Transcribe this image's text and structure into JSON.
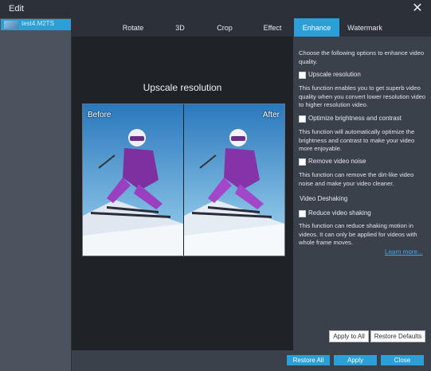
{
  "window": {
    "title": "Edit"
  },
  "file_list": {
    "items": [
      {
        "name": "test4.M2TS"
      }
    ]
  },
  "tabs": [
    {
      "label": "Rotate"
    },
    {
      "label": "3D"
    },
    {
      "label": "Crop"
    },
    {
      "label": "Effect"
    },
    {
      "label": "Enhance",
      "active": true
    },
    {
      "label": "Watermark"
    }
  ],
  "preview": {
    "label": "Upscale resolution",
    "before": "Before",
    "after": "After"
  },
  "panel": {
    "intro": "Choose the following options to enhance video quality.",
    "options": [
      {
        "label": "Upscale resolution",
        "checked": false,
        "desc": "This function enables you to get superb video quality when you convert lower resolution video to higher resolution video."
      },
      {
        "label": "Optimize brightness and contrast",
        "checked": false,
        "desc": "This function will automatically optimize the brightness and contrast to make your video more enjoyable."
      },
      {
        "label": "Remove video noise",
        "checked": false,
        "desc": "This function can remove the dirt-like video noise and make your video cleaner."
      }
    ],
    "deshake": {
      "section": "Video Deshaking",
      "label": "Reduce video shaking",
      "checked": false,
      "desc": "This function can reduce shaking motion in videos. It can only be applied for videos with whole frame moves."
    },
    "learn_more": "Learn more...",
    "apply_to_all": "Apply to All",
    "restore_defaults": "Restore Defaults"
  },
  "footer": {
    "restore_all": "Restore All",
    "apply": "Apply",
    "close": "Close"
  },
  "colors": {
    "accent": "#2a9fd8",
    "background": "#3b414b",
    "preview_bg": "#1f2226"
  },
  "icons": {
    "close": "close-icon",
    "checkbox": "checkbox-icon"
  }
}
